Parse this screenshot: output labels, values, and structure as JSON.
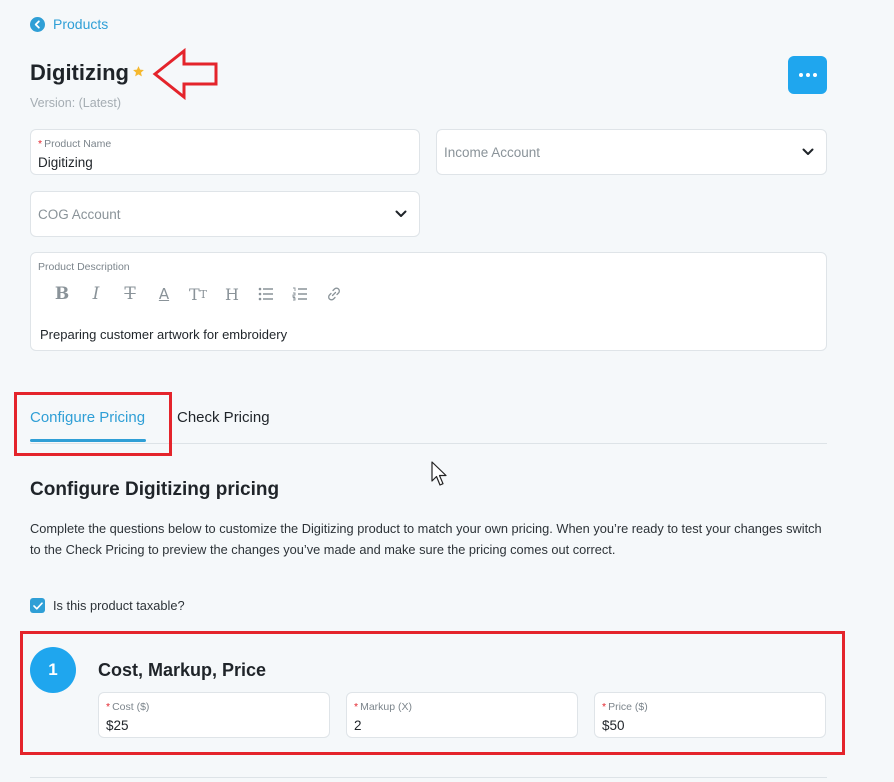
{
  "nav": {
    "back_label": "Products"
  },
  "header": {
    "title": "Digitizing",
    "version": "Version: (Latest)"
  },
  "form": {
    "product_name": {
      "label": "Product Name",
      "value": "Digitizing"
    },
    "income_account": {
      "placeholder": "Income Account"
    },
    "cog_account": {
      "placeholder": "COG Account"
    },
    "description": {
      "label": "Product Description",
      "value": "Preparing customer artwork for embroidery"
    },
    "toolbar_icons": [
      "bold-icon",
      "italic-icon",
      "strikethrough-icon",
      "underline-color-icon",
      "text-size-icon",
      "heading-icon",
      "bullet-list-icon",
      "numbered-list-icon",
      "link-icon"
    ]
  },
  "tabs": {
    "configure": "Configure Pricing",
    "check": "Check Pricing"
  },
  "configure": {
    "title": "Configure Digitizing pricing",
    "description": "Complete the questions below to customize the Digitizing product to match your own pricing. When you’re ready to test your changes switch to the Check Pricing to preview the changes you’ve made and make sure the pricing comes out correct.",
    "taxable_label": "Is this product taxable?",
    "taxable_checked": true
  },
  "step1": {
    "number": "1",
    "title": "Cost, Markup, Price",
    "cost": {
      "label": "Cost ($)",
      "value": "$25"
    },
    "markup": {
      "label": "Markup (X)",
      "value": "2"
    },
    "price": {
      "label": "Price ($)",
      "value": "$50"
    }
  },
  "colors": {
    "accent": "#2f9fd6",
    "button": "#1fa6ee",
    "annotation": "#e4242b",
    "star": "#f5b82e"
  }
}
